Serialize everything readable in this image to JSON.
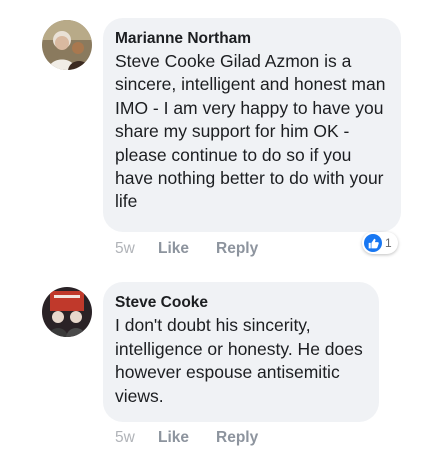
{
  "comments": [
    {
      "author": "Marianne Northam",
      "text": "Steve Cooke Gilad Azmon is a sincere, intelligent and honest man IMO - I am very happy to have you share  my support for him OK - please continue to do so if you have nothing better to do with your life",
      "time": "5w",
      "like_label": "Like",
      "reply_label": "Reply",
      "reactions": {
        "icon": "thumbs-up-icon",
        "count": "1"
      }
    },
    {
      "author": "Steve Cooke",
      "text": "I don't doubt his sincerity, intelligence or honesty. He does however espouse antisemitic views.",
      "time": "5w",
      "like_label": "Like",
      "reply_label": "Reply"
    }
  ],
  "colors": {
    "bubble": "#f0f2f5",
    "reaction_blue": "#1877f2",
    "meta_gray": "#8d949e"
  }
}
